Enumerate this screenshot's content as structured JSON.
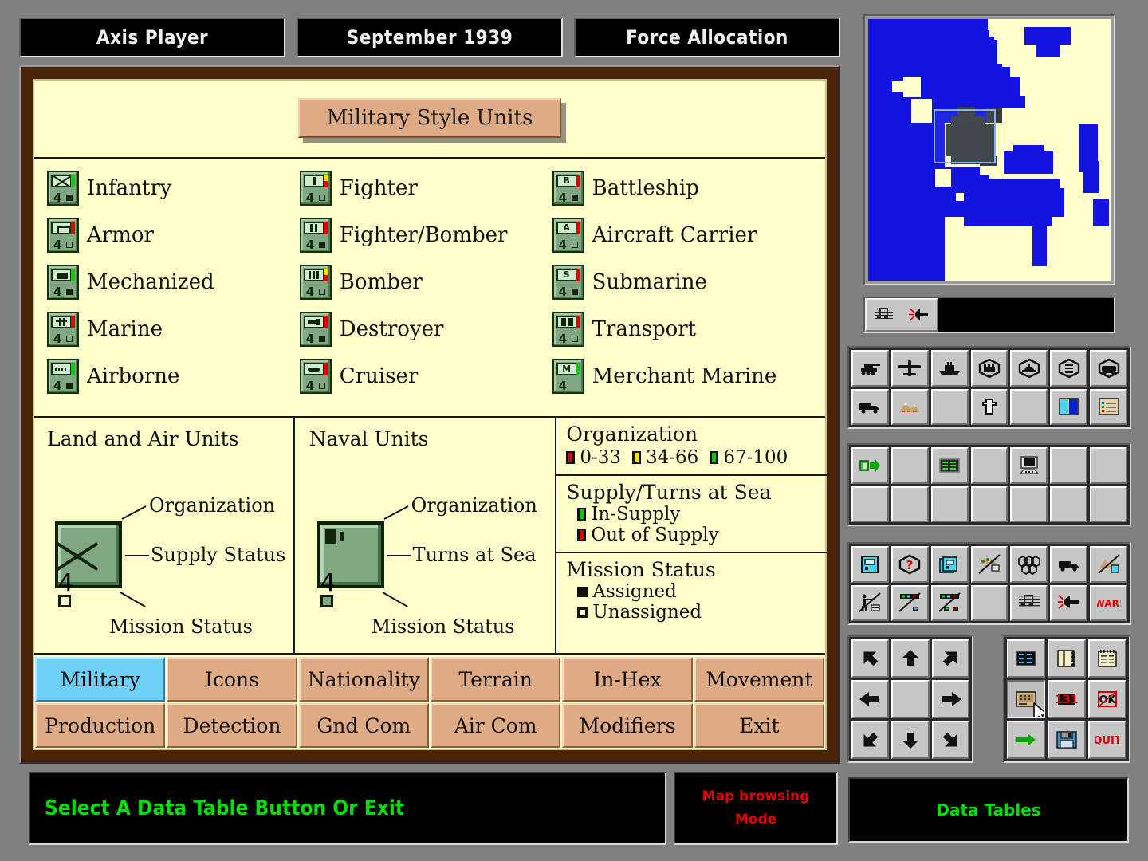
{
  "header": {
    "player": "Axis Player",
    "date": "September 1939",
    "mode": "Force Allocation"
  },
  "panel": {
    "title": "Military Style Units",
    "unit_columns": [
      [
        {
          "label": "Infantry",
          "symbol": "x",
          "org": "green",
          "mission": "filled"
        },
        {
          "label": "Armor",
          "symbol": "box",
          "org": "red",
          "mission": "open"
        },
        {
          "label": "Mechanized",
          "symbol": "fill",
          "org": "green",
          "mission": "filled"
        },
        {
          "label": "Marine",
          "symbol": "mar",
          "org": "red",
          "mission": "open"
        },
        {
          "label": "Airborne",
          "symbol": "wave",
          "org": "green",
          "mission": "filled"
        }
      ],
      [
        {
          "label": "Fighter",
          "symbol": "bar1",
          "org": "yellow",
          "mission": "open"
        },
        {
          "label": "Fighter/Bomber",
          "symbol": "bar2",
          "org": "red",
          "mission": "filled"
        },
        {
          "label": "Bomber",
          "symbol": "bar3",
          "org": "yellow",
          "mission": "open"
        },
        {
          "label": "Destroyer",
          "symbol": "ship",
          "org": "red",
          "mission": "filled"
        },
        {
          "label": "Cruiser",
          "symbol": "sub",
          "org": "red",
          "mission": "open"
        }
      ],
      [
        {
          "label": "Battleship",
          "symbol": "B",
          "org": "red",
          "mission": "filled"
        },
        {
          "label": "Aircraft Carrier",
          "symbol": "A",
          "org": "red",
          "mission": "open"
        },
        {
          "label": "Submarine",
          "symbol": "S",
          "org": "red",
          "mission": "filled"
        },
        {
          "label": "Transport",
          "symbol": "tr",
          "org": "red",
          "mission": "open"
        },
        {
          "label": "Merchant Marine",
          "symbol": "M",
          "org": "green",
          "mission": "none"
        }
      ]
    ],
    "legend": {
      "land": {
        "title": "Land and Air Units",
        "callout_org": "Organization",
        "callout_mid": "Supply Status",
        "callout_bottom": "Mission Status",
        "counter_number": "4"
      },
      "naval": {
        "title": "Naval Units",
        "callout_org": "Organization",
        "callout_mid": "Turns at Sea",
        "callout_bottom": "Mission Status",
        "counter_number": "4"
      },
      "organization": {
        "title": "Organization",
        "ranges": [
          {
            "label": "0-33",
            "color": "#e00000"
          },
          {
            "label": "34-66",
            "color": "#ffe000"
          },
          {
            "label": "67-100",
            "color": "#00d000"
          }
        ]
      },
      "supply": {
        "title": "Supply/Turns at Sea",
        "items": [
          {
            "label": "In-Supply",
            "color": "#00d000"
          },
          {
            "label": "Out of Supply",
            "color": "#e00000"
          }
        ]
      },
      "mission": {
        "title": "Mission Status",
        "items": [
          {
            "label": "Assigned",
            "style": "filled"
          },
          {
            "label": "Unassigned",
            "style": "open"
          }
        ]
      }
    },
    "tabs_row1": [
      {
        "label": "Military",
        "active": true
      },
      {
        "label": "Icons",
        "active": false
      },
      {
        "label": "Nationality",
        "active": false
      },
      {
        "label": "Terrain",
        "active": false
      },
      {
        "label": "In-Hex",
        "active": false
      },
      {
        "label": "Movement",
        "active": false
      }
    ],
    "tabs_row2": [
      {
        "label": "Production",
        "active": false
      },
      {
        "label": "Detection",
        "active": false
      },
      {
        "label": "Gnd Com",
        "active": false
      },
      {
        "label": "Air Com",
        "active": false
      },
      {
        "label": "Modifiers",
        "active": false
      },
      {
        "label": "Exit",
        "active": false
      }
    ]
  },
  "status": {
    "prompt": "Select A Data Table Button Or Exit",
    "mode_line1": "Map browsing",
    "mode_line2": "Mode",
    "right_panel": "Data Tables"
  },
  "sidebar": {
    "sound_icons": [
      "music-note-icon",
      "speaker-icon"
    ],
    "toolbar1": [
      "tank-icon",
      "aircraft-icon",
      "ship-icon",
      "factory-hex-icon",
      "port-hex-icon",
      "oil-hex-icon",
      "rail-hex-icon",
      "supply-truck-icon",
      "mountain-terrain-icon",
      "blank",
      "cross-marker-icon",
      "blank",
      "color-bars-icon",
      "legend-list-icon"
    ],
    "toolbar2": [
      "unit-move-arrow-icon",
      "blank",
      "data-table-icon",
      "blank",
      "computer-icon",
      "blank",
      "blank",
      "blank",
      "blank",
      "blank",
      "blank",
      "blank",
      "blank",
      "blank"
    ],
    "toolbar3": [
      "unit-counter-icon",
      "unknown-hex-icon",
      "stacked-counters-icon",
      "terrain-off-icon",
      "hex-grid-icon",
      "supply-truck-icon",
      "elevation-off-icon",
      "infantry-off-icon",
      "org-bars-off-icon",
      "status-bars-off-icon",
      "blank",
      "music-note-icon",
      "speaker-icon",
      "war-indicator"
    ],
    "toolbar3_labels": {
      "war": "WAR!"
    },
    "arrows": [
      "arrow-up-left",
      "arrow-up",
      "arrow-up-right",
      "arrow-left",
      "blank",
      "arrow-right",
      "arrow-down-left",
      "arrow-down",
      "arrow-down-right"
    ],
    "commands": [
      {
        "name": "data-table-blue-icon",
        "label": ""
      },
      {
        "name": "notebook-icon",
        "label": ""
      },
      {
        "name": "notepad-icon",
        "label": ""
      },
      {
        "name": "data-table-tan-icon",
        "label": ""
      },
      {
        "name": "counter-131-icon",
        "label": "131"
      },
      {
        "name": "ok-disabled-icon",
        "label": "OK"
      },
      {
        "name": "next-arrow-icon",
        "label": ""
      },
      {
        "name": "save-floppy-icon",
        "label": ""
      },
      {
        "name": "quit-button",
        "label": "QUIT"
      }
    ]
  }
}
